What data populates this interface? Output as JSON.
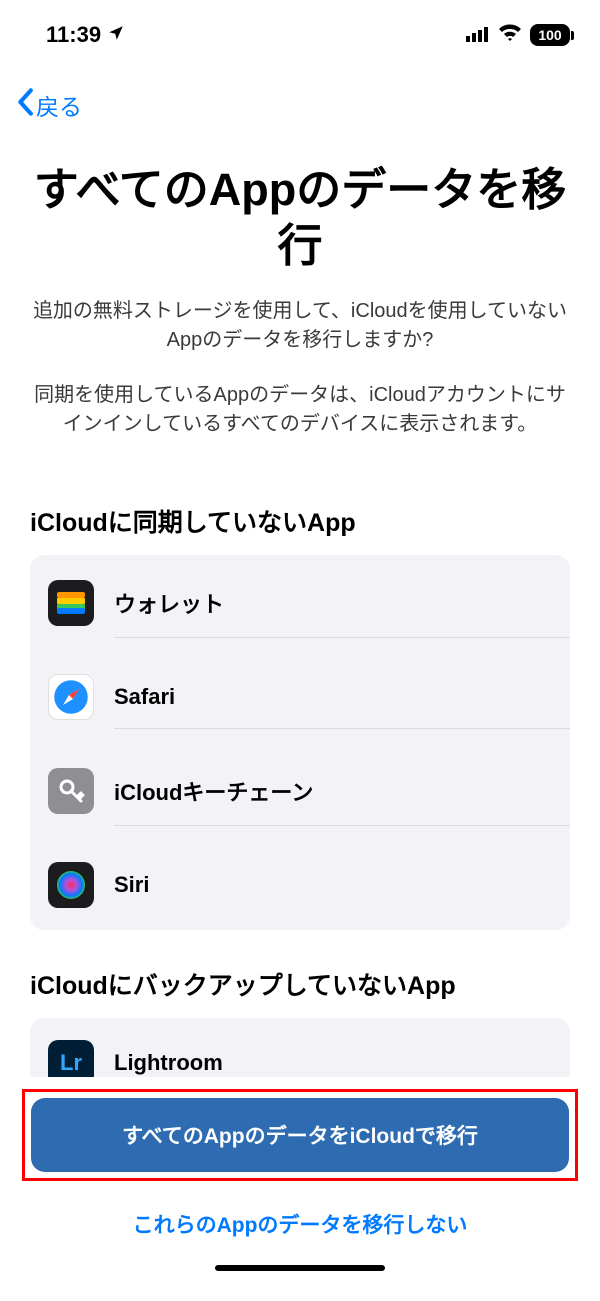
{
  "status_bar": {
    "time": "11:39",
    "battery": "100"
  },
  "nav": {
    "back_label": "戻る"
  },
  "header": {
    "title": "すべてのAppのデータを移行",
    "desc1": "追加の無料ストレージを使用して、iCloudを使用していないAppのデータを移行しますか?",
    "desc2": "同期を使用しているAppのデータは、iCloudアカウントにサインインしているすべてのデバイスに表示されます。"
  },
  "sections": {
    "not_synced": {
      "title": "iCloudに同期していないApp",
      "items": [
        {
          "label": "ウォレット"
        },
        {
          "label": "Safari"
        },
        {
          "label": "iCloudキーチェーン"
        },
        {
          "label": "Siri"
        }
      ]
    },
    "not_backed_up": {
      "title": "iCloudにバックアップしていないApp",
      "items": [
        {
          "label": "Lightroom"
        }
      ]
    }
  },
  "footer": {
    "primary": "すべてのAppのデータをiCloudで移行",
    "secondary": "これらのAppのデータを移行しない"
  }
}
